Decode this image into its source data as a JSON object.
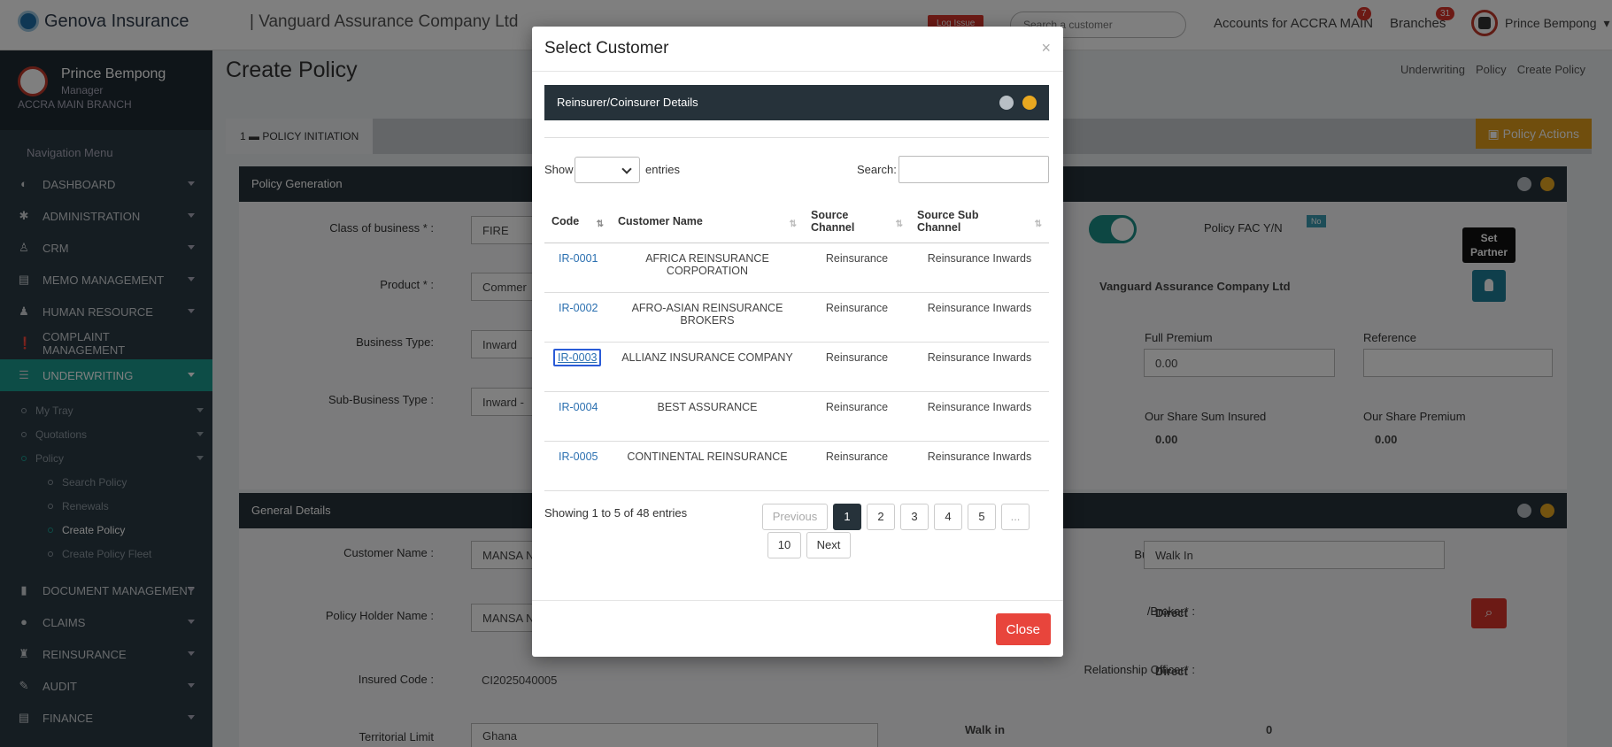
{
  "topbar": {
    "brand": "Genova Insurance",
    "company": "| Vanguard Assurance Company Ltd",
    "log_issue": "Log Issue",
    "search_placeholder": "Search a customer",
    "accounts_label": "Accounts for ACCRA MAIN",
    "accounts_badge": "7",
    "branches_label": "Branches",
    "branches_badge": "31",
    "user_name": "Prince Bempong"
  },
  "sidebar": {
    "user_name": "Prince Bempong",
    "user_role": "Manager",
    "branch": "ACCRA MAIN BRANCH",
    "nav_title": "Navigation Menu",
    "items": [
      {
        "label": "DASHBOARD",
        "icon": "◐"
      },
      {
        "label": "ADMINISTRATION",
        "icon": "✱"
      },
      {
        "label": "CRM",
        "icon": "♙"
      },
      {
        "label": "MEMO MANAGEMENT",
        "icon": "▤"
      },
      {
        "label": "HUMAN RESOURCE",
        "icon": "♟"
      },
      {
        "label": "COMPLAINT MANAGEMENT",
        "icon": "❗"
      },
      {
        "label": "UNDERWRITING",
        "icon": "☰"
      }
    ],
    "sub_items": [
      "My Tray",
      "Quotations",
      "Policy"
    ],
    "policy_sub": [
      "Search Policy",
      "Renewals",
      "Create Policy",
      "Create Policy Fleet"
    ],
    "items_after": [
      {
        "label": "DOCUMENT MANAGEMENT",
        "icon": "▮"
      },
      {
        "label": "CLAIMS",
        "icon": "●"
      },
      {
        "label": "REINSURANCE",
        "icon": "♜"
      },
      {
        "label": "AUDIT",
        "icon": "✎"
      },
      {
        "label": "FINANCE",
        "icon": "▤"
      }
    ]
  },
  "main": {
    "page_title": "Create Policy",
    "breadcrumb": [
      "Underwriting",
      "Policy",
      "Create Policy"
    ],
    "tab_label": "1 ▬ POLICY INITIATION",
    "policy_actions": "▣ Policy Actions",
    "panel1_title": "Policy Generation",
    "class_label": "Class of business * :",
    "class_value": "FIRE",
    "product_label": "Product * :",
    "product_value": "Commer",
    "business_type_label": "Business Type:",
    "business_type_value": "Inward",
    "sub_business_label": "Sub-Business Type :",
    "sub_business_value": "Inward - ",
    "policy_fac_label": "Policy FAC Y/N",
    "policy_fac_badge": "No",
    "company_value": "Vanguard Assurance Company Ltd",
    "set_partner": "Set Partner",
    "full_premium_label": "Full Premium",
    "full_premium_value": "0.00",
    "reference_label": "Reference",
    "our_share_sum_label": "Our Share Sum Insured",
    "our_share_sum_value": "0.00",
    "our_share_premium_label": "Our Share Premium",
    "our_share_premium_value": "0.00",
    "panel2_title": "General Details",
    "customer_name_label": "Customer Name :",
    "customer_name_value": "MANSA N",
    "holder_label": "Policy Holder Name :",
    "holder_value": "MANSA N",
    "insured_code_label": "Insured Code :",
    "insured_code_value": "CI2025040005",
    "territorial_label": "Territorial Limit",
    "territorial_value": "Ghana",
    "source_business_label": "Business * :",
    "source_business_value": "Walk In",
    "agent_label": "/Broker* :",
    "agent_value": "Direct",
    "relationship_label": "Relationship Officer* :",
    "relationship_value": "Direct",
    "walk_in_label": "Walk in",
    "walk_in_value": "0"
  },
  "modal": {
    "title": "Select Customer",
    "close_x": "×",
    "section_title": "Reinsurer/Coinsurer Details",
    "show_label": "Show",
    "entries_label": "entries",
    "search_label": "Search:",
    "columns": [
      "Code",
      "Customer Name",
      "Source Channel",
      "Source Sub Channel"
    ],
    "rows": [
      {
        "code": "IR-0001",
        "name": "AFRICA REINSURANCE CORPORATION",
        "channel": "Reinsurance",
        "sub": "Reinsurance Inwards"
      },
      {
        "code": "IR-0002",
        "name": "AFRO-ASIAN REINSURANCE BROKERS",
        "channel": "Reinsurance",
        "sub": "Reinsurance Inwards"
      },
      {
        "code": "IR-0003",
        "name": "ALLIANZ INSURANCE COMPANY",
        "channel": "Reinsurance",
        "sub": "Reinsurance Inwards"
      },
      {
        "code": "IR-0004",
        "name": "BEST ASSURANCE",
        "channel": "Reinsurance",
        "sub": "Reinsurance Inwards"
      },
      {
        "code": "IR-0005",
        "name": "CONTINENTAL REINSURANCE",
        "channel": "Reinsurance",
        "sub": "Reinsurance Inwards"
      }
    ],
    "info": "Showing 1 to 5 of 48 entries",
    "pager": {
      "previous": "Previous",
      "pages": [
        "1",
        "2",
        "3",
        "4",
        "5",
        "...",
        "10"
      ],
      "next": "Next"
    },
    "close_button": "Close"
  }
}
